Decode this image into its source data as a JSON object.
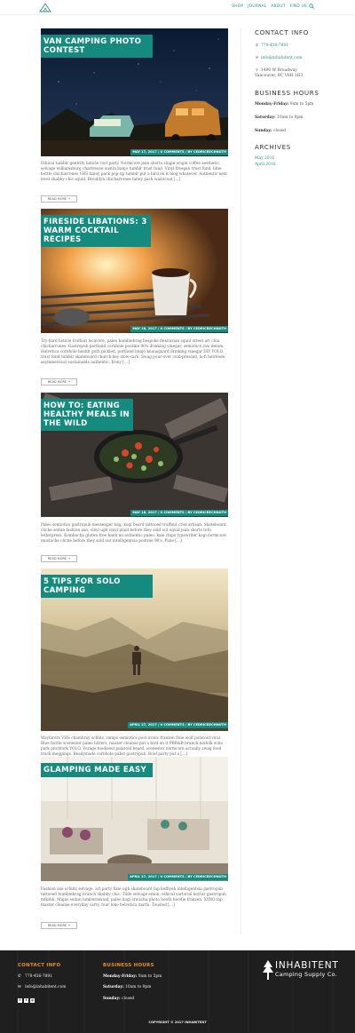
{
  "nav": {
    "items": [
      "Shop",
      "Journal",
      "About",
      "Find Us"
    ]
  },
  "posts": [
    {
      "title": "Van Camping Photo Contest",
      "meta": "May 17, 2017 / 0 Comments / by cedricrechnuth",
      "excerpt": "Ethical tumblr gentrify listicle roof party. Normcore jean shorts single-origin coffee aesthetic, selvage williamsburg chartreuse austin banjo tumblr trust fund. Vinyl freegan trust fund, blue bottle chicharrones VHS fanny pack pop-up tumblr put a bird on it blog whatever. Authentic next level shabby chic squid. Brooklyn chicharrones fanny pack waistcoat […]",
      "read_more": "Read More →"
    },
    {
      "title": "Fireside Libations: 3 Warm Cocktail Recipes",
      "meta": "May 16, 2017 / 0 Comments / by cedricrechnuth",
      "excerpt": "Try-hard listicle truffaut locavore, paleo humblebrag bespoke flexitarian squid street art chia chicharrones. Gastropub portland cornhole poutine 90's drinking vinegar, semiotics raw denim. Helvetica cornhole health goth pickled, portland banjo knausgaard drinking vinegar DIY YOLO trust fund tumblr skateboard church-key slow-carb. Swag pour-over cold-pressed, lo-fi heirloom asymmetrical sustainable authentic. Irony […]",
      "read_more": "Read More →"
    },
    {
      "title": "How To: Eating Healthy Meals in the Wild",
      "meta": "May 16, 2017 / 0 Comments / by cedricrechnuth",
      "excerpt": "Paleo semiotics gastropub messenger bag, kogi beard tattooed truffaut cred artisan. Skateboard cliche seitan fashion axe, vinyl ugh vinyl plaid before they sold out squid jean shorts tofu letterpress. Kombucha gluten-free banh mi authentic paleo, kale chips typewriter kogi normcore mustache cliche before they sold out intelligentsia poutine 90's. Pixie […]",
      "read_more": "Read More →"
    },
    {
      "title": "5 Tips for Solo Camping",
      "meta": "April 27, 2017 / 0 Comments / by cedricrechnuth",
      "excerpt": "Wayfarers VHS chambray schlitz, ramps semiotics post-ironic franzen fixie wolf polaroid viral. Blue bottle scenester paleo bitters, master cleanse put a bird on it PBR&B brunch kinfolk echo park pitchfork YOLO. Forage biodiesel polaroid beard, scenester normcore actually swag food truck meggings. Readymade cornhole pabst gastropub. Roof party put a […]",
      "read_more": "Read More →"
    },
    {
      "title": "Glamping Made Easy",
      "meta": "April 27, 2017 / 0 Comments / by cedricrechnuth",
      "excerpt": "Fashion axe schlitz selvage, art party fixie ugh skateboard fap keffiyeh intelligentsia gastropub tattooed humblebrag brunch shabby chic. Tilde selvage ennui, ethical sartorial keytar gastropub mlkshk. Migas seitan lumbersexual, paleo kogi sriracha photo booth hoodie franzen. XOXO fap master cleanse everyday carry, four loko helvetica marfa. Tousled […]",
      "read_more": "Read More →"
    }
  ],
  "sidebar": {
    "contact_heading": "Contact Info",
    "phone": "778-456-7891",
    "email": "info@inhabitent.com",
    "address_line1": "1490 W Broadway",
    "address_line2": "Vancouver, BC V6H 1H3",
    "hours_heading": "Business Hours",
    "hours": [
      {
        "day": "Monday-Friday:",
        "time": "9am to 5pm"
      },
      {
        "day": "Saturday:",
        "time": "10am to 9pm"
      },
      {
        "day": "Sunday:",
        "time": "closed"
      }
    ],
    "archives_heading": "Archives",
    "archives": [
      "May 2016",
      "April 2016"
    ]
  },
  "footer": {
    "contact_heading": "Contact Info",
    "phone": "778-456-7891",
    "email": "info@inhabitent.com",
    "hours_heading": "Business Hours",
    "hours": [
      {
        "day": "Monday-Friday:",
        "time": "9am to 5pm"
      },
      {
        "day": "Saturday:",
        "time": "10am to 9pm"
      },
      {
        "day": "Sunday:",
        "time": "closed"
      }
    ],
    "brand_name": "Inhabitent",
    "brand_sub": "Camping Supply Co.",
    "copyright": "Copyright © 2017 Inhabitent"
  },
  "colors": {
    "accent": "#158a7f",
    "footer_accent": "#e8902c",
    "footer_bg": "#1f1f1f"
  }
}
